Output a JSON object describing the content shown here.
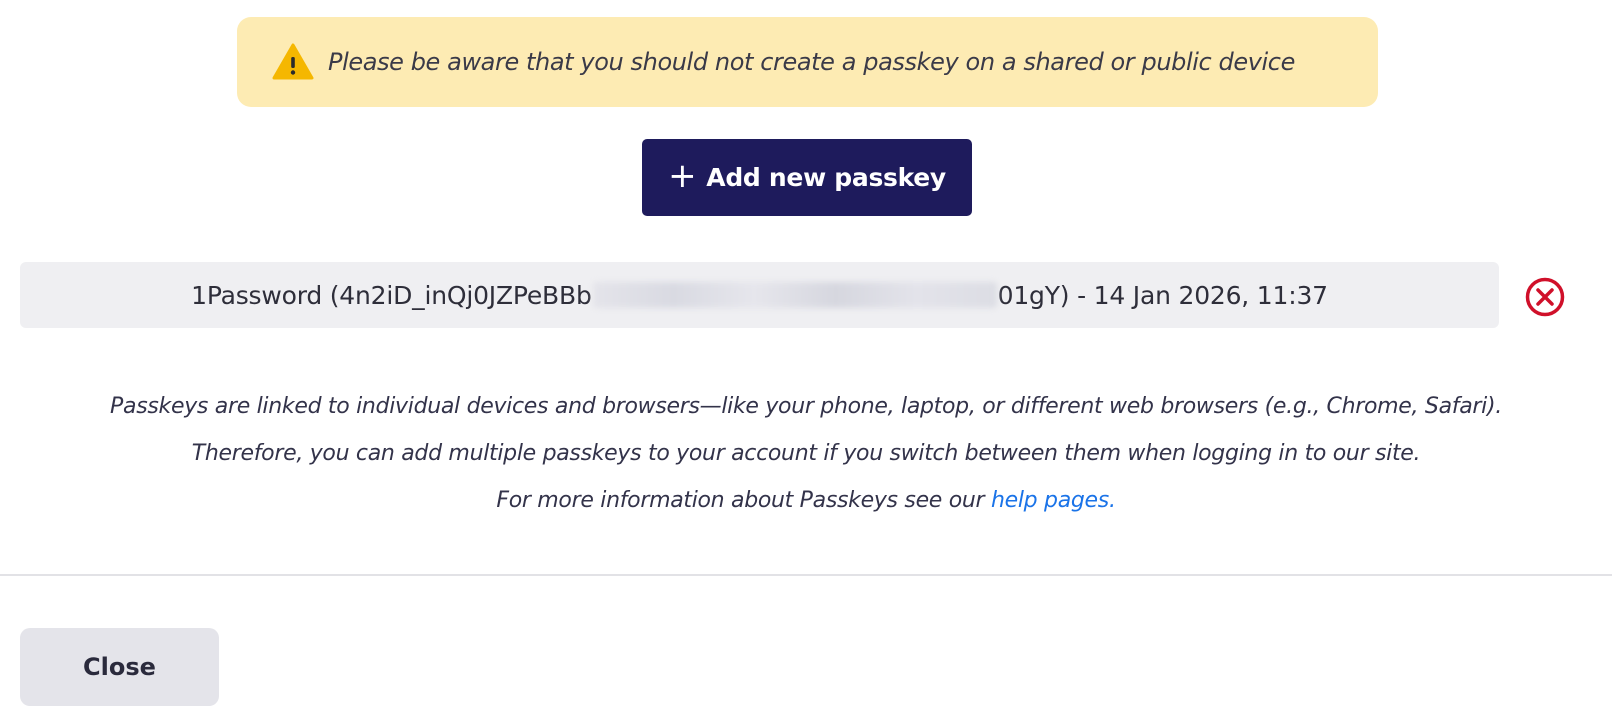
{
  "warning": {
    "icon": "warning-triangle-icon",
    "text": "Please be aware that you should not create a passkey on a shared or public device",
    "background": "#fdebb3",
    "icon_color": "#f5b700"
  },
  "add_button": {
    "icon": "plus-icon",
    "label": "Add new passkey",
    "background": "#1e1b5c"
  },
  "passkeys": [
    {
      "name_prefix": "1Password (4n2iD_inQj0JZPeBBb",
      "name_suffix": "01gY) - 14 Jan 2026, 11:37",
      "delete_icon": "circle-x-icon",
      "delete_color": "#d0102a"
    }
  ],
  "info": {
    "line1": "Passkeys are linked to individual devices and browsers—like your phone, laptop, or different web browsers (e.g., Chrome, Safari).",
    "line2": "Therefore, you can add multiple passkeys to your account if you switch between them when logging in to our site.",
    "line3_prefix": "For more information about Passkeys see our ",
    "help_link": "help pages."
  },
  "footer": {
    "close_label": "Close"
  }
}
